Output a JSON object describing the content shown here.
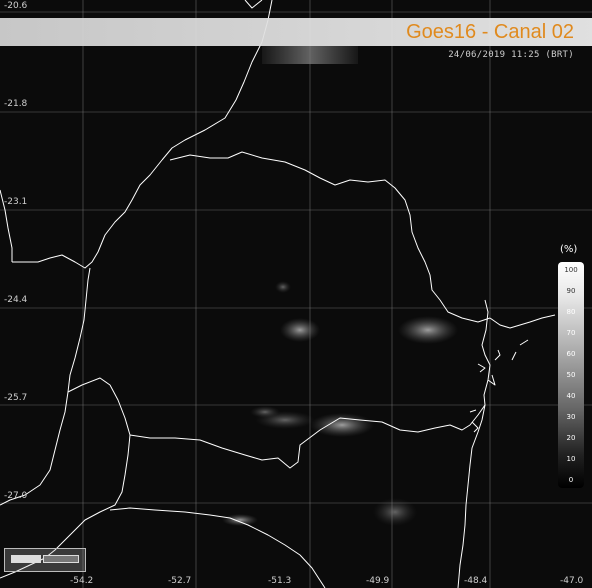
{
  "header": {
    "title": "Goes16 - Canal 02",
    "timestamp": "24/06/2019 11:25 (BRT)"
  },
  "latitude_labels": [
    "-20.6",
    "-21.8",
    "-23.1",
    "-24.4",
    "-25.7",
    "-27.0"
  ],
  "longitude_labels": [
    "-54.2",
    "-52.7",
    "-51.3",
    "-49.9",
    "-48.4",
    "-47.0"
  ],
  "colorbar": {
    "unit": "(%)",
    "ticks": [
      "100",
      "90",
      "80",
      "70",
      "60",
      "50",
      "40",
      "30",
      "20",
      "10",
      "0"
    ]
  },
  "colors": {
    "title": "#e08a1e",
    "border_lines": "#ffffff",
    "grid_lines": "#8a8a8a",
    "background": "#0a0a0a"
  }
}
